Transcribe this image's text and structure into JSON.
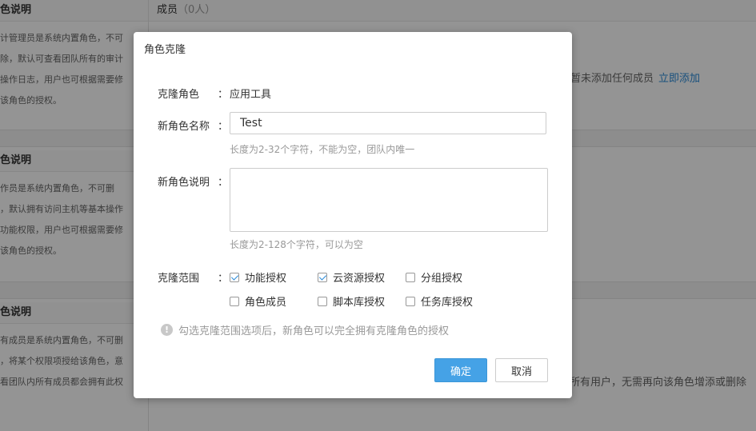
{
  "background": {
    "members_header": {
      "title": "成员",
      "count": "（0人）"
    },
    "roles": [
      {
        "title": "色说明",
        "lines": [
          "计管理员是系统内置角色，不可",
          "除，默认可查看团队所有的审计",
          "操作日志，用户也可根据需要修",
          "该角色的授权。"
        ]
      },
      {
        "title": "色说明",
        "lines": [
          "作员是系统内置角色，不可删",
          "，默认拥有访问主机等基本操作",
          "功能权限，用户也可根据需要修",
          "该角色的授权。"
        ]
      },
      {
        "title": "色说明",
        "lines": [
          "有成员是系统内置角色，不可删",
          "，将某个权限项授给该角色，意",
          "看团队内所有成员都会拥有此权"
        ]
      }
    ],
    "empty_members": "色暂未添加任何成员",
    "add_now_link": "立即添加",
    "all_users_note": "所有用户，无需再向该角色增添或删除"
  },
  "modal": {
    "title": "角色克隆",
    "clone_role_label": "克隆角色",
    "colon": "：",
    "clone_role_value": "应用工具",
    "new_name_label": "新角色名称",
    "new_name_value": "Test",
    "new_name_hint": "长度为2-32个字符，不能为空，团队内唯一",
    "new_desc_label": "新角色说明",
    "new_desc_value": "",
    "new_desc_hint": "长度为2-128个字符，可以为空",
    "scope_label": "克隆范围",
    "scope_options": [
      {
        "label": "功能授权",
        "checked": true
      },
      {
        "label": "云资源授权",
        "checked": true
      },
      {
        "label": "分组授权",
        "checked": false
      },
      {
        "label": "角色成员",
        "checked": false
      },
      {
        "label": "脚本库授权",
        "checked": false
      },
      {
        "label": "任务库授权",
        "checked": false
      }
    ],
    "info_icon": "!",
    "info_text": "勾选克隆范围选项后，新角色可以完全拥有克隆角色的授权",
    "confirm_label": "确定",
    "cancel_label": "取消"
  },
  "colors": {
    "accent": "#45a2e6",
    "link": "#2a8ad8",
    "overlay": "rgba(0,0,0,0.42)"
  }
}
